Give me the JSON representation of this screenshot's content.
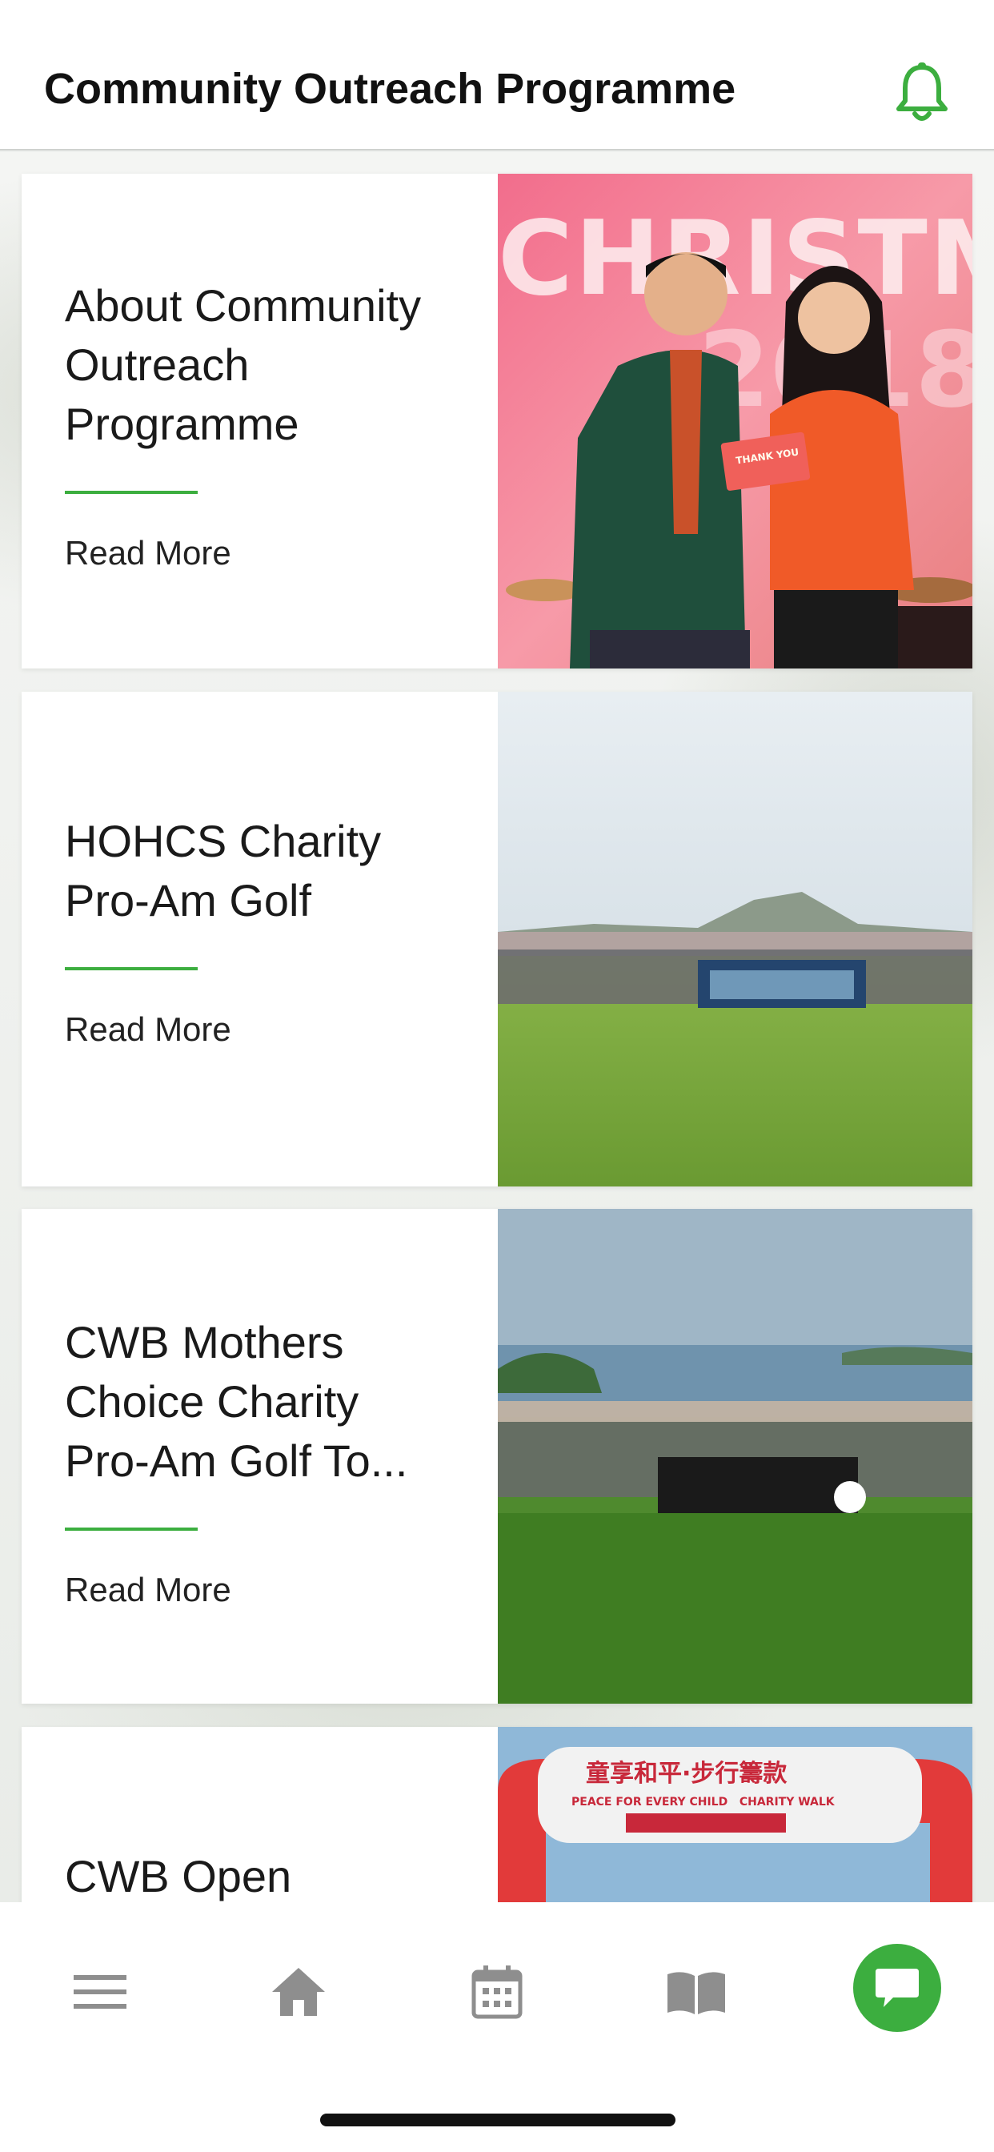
{
  "header": {
    "title": "Community Outreach Programme",
    "notification_icon": "bell-icon",
    "accent": "#3cae3f"
  },
  "cards": [
    {
      "title_lines": [
        "About Community",
        "Outreach",
        "Programme"
      ],
      "read_more": "Read More",
      "image": "christmas-event-photo",
      "image_text": "CHRISTM",
      "badge_text": "THANK YOU"
    },
    {
      "title_lines": [
        "HOHCS Charity",
        "Pro-Am Golf"
      ],
      "read_more": "Read More",
      "image": "golf-group-photo"
    },
    {
      "title_lines": [
        "CWB Mothers",
        "Choice Charity",
        "Pro-Am Golf To..."
      ],
      "read_more": "Read More",
      "image": "golf-group-sea-photo"
    },
    {
      "title_lines": [
        "CWB Open"
      ],
      "image": "charity-walk-photo",
      "image_text": "PEACE FOR EVERY CHILD   CHARITY WALK"
    }
  ],
  "tabbar": {
    "items": [
      {
        "icon": "menu-icon"
      },
      {
        "icon": "home-icon"
      },
      {
        "icon": "calendar-icon"
      },
      {
        "icon": "book-icon"
      },
      {
        "icon": "chat-icon",
        "active": true
      }
    ],
    "icon_color": "#8e8e8e",
    "active_color": "#3cae3f"
  }
}
